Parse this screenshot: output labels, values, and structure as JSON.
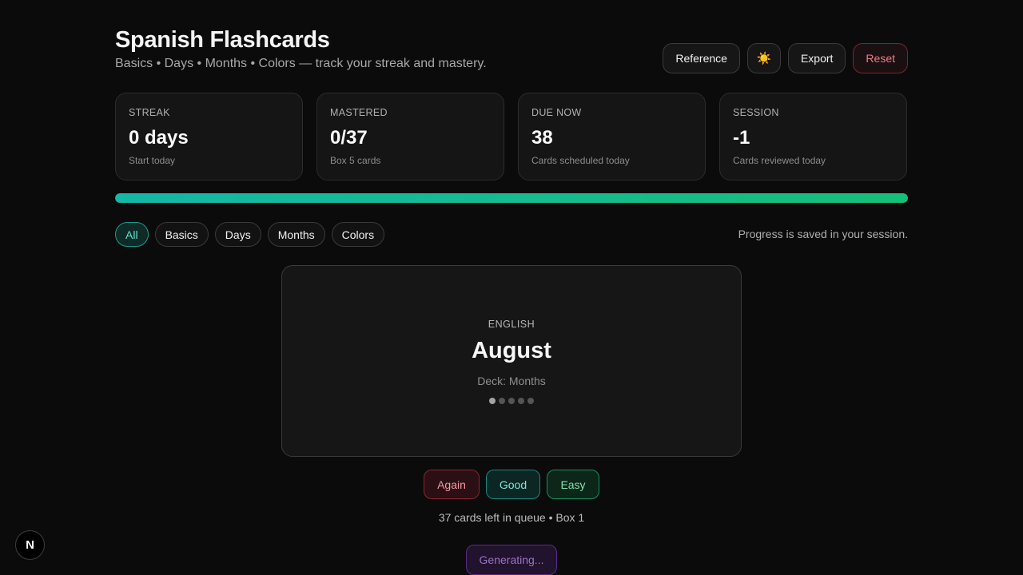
{
  "header": {
    "title": "Spanish Flashcards",
    "subtitle": "Basics • Days • Months • Colors — track your streak and mastery."
  },
  "actions": {
    "reference": "Reference",
    "theme_icon": "sun-icon",
    "theme_glyph": "☀️",
    "export": "Export",
    "reset": "Reset"
  },
  "stats": [
    {
      "label": "STREAK",
      "value": "0 days",
      "sub": "Start today"
    },
    {
      "label": "MASTERED",
      "value": "0/37",
      "sub": "Box 5 cards"
    },
    {
      "label": "DUE NOW",
      "value": "38",
      "sub": "Cards scheduled today"
    },
    {
      "label": "SESSION",
      "value": "-1",
      "sub": "Cards reviewed today"
    }
  ],
  "progress": {
    "fraction": 1.0
  },
  "filters": {
    "items": [
      "All",
      "Basics",
      "Days",
      "Months",
      "Colors"
    ],
    "active": "All",
    "saved_note": "Progress is saved in your session."
  },
  "card": {
    "language": "ENGLISH",
    "word": "August",
    "deck": "Deck: Months",
    "box_level": 1,
    "box_total": 5
  },
  "grades": {
    "again": "Again",
    "good": "Good",
    "easy": "Easy"
  },
  "queue_text": "37 cards left in queue • Box 1",
  "generating": "Generating...",
  "logo": {
    "icon": "n-logo-icon",
    "glyph": "N"
  },
  "colors": {
    "accent": "#13b8a6",
    "again": "#f49aa2",
    "good": "#7fe6d6",
    "easy": "#7fe3ad",
    "generating": "#9b74c2"
  }
}
